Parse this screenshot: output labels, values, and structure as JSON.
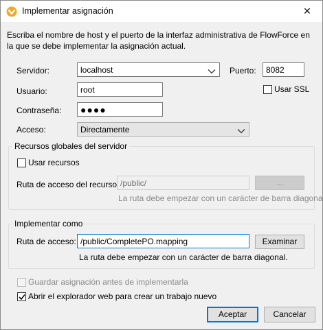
{
  "window": {
    "title": "Implementar asignación",
    "close_glyph": "✕",
    "icon": "altova-mapforce-icon"
  },
  "description": "Escriba el nombre de host y el puerto de la interfaz administrativa de FlowForce en la que se debe implementar la asignación actual.",
  "server": {
    "label": "Servidor:",
    "value": "localhost"
  },
  "port": {
    "label": "Puerto:",
    "value": "8082"
  },
  "use_ssl": {
    "label": "Usar SSL",
    "checked": false
  },
  "user": {
    "label": "Usuario:",
    "value": "root"
  },
  "password": {
    "label": "Contraseña:",
    "value": "●●●●"
  },
  "access": {
    "label": "Acceso:",
    "value": "Directamente"
  },
  "global_resources": {
    "group_title": "Recursos globales del servidor",
    "use_resources_label": "Usar recursos",
    "use_resources_checked": false,
    "path_label": "Ruta de acceso del recurso:",
    "path_value": "/public/",
    "browse_label": "...",
    "hint": "La ruta debe empezar con un carácter de barra diagonal."
  },
  "deploy_as": {
    "group_title": "Implementar como",
    "path_label": "Ruta de acceso:",
    "path_value": "/public/CompletePO.mapping",
    "browse_label": "Examinar",
    "hint": "La ruta debe empezar con un carácter de barra diagonal."
  },
  "save_before": {
    "label": "Guardar asignación antes de implementarla",
    "checked": false,
    "disabled": true
  },
  "open_browser": {
    "label": "Abrir el explorador web para crear un trabajo nuevo",
    "checked": true
  },
  "buttons": {
    "ok": "Aceptar",
    "cancel": "Cancelar"
  }
}
